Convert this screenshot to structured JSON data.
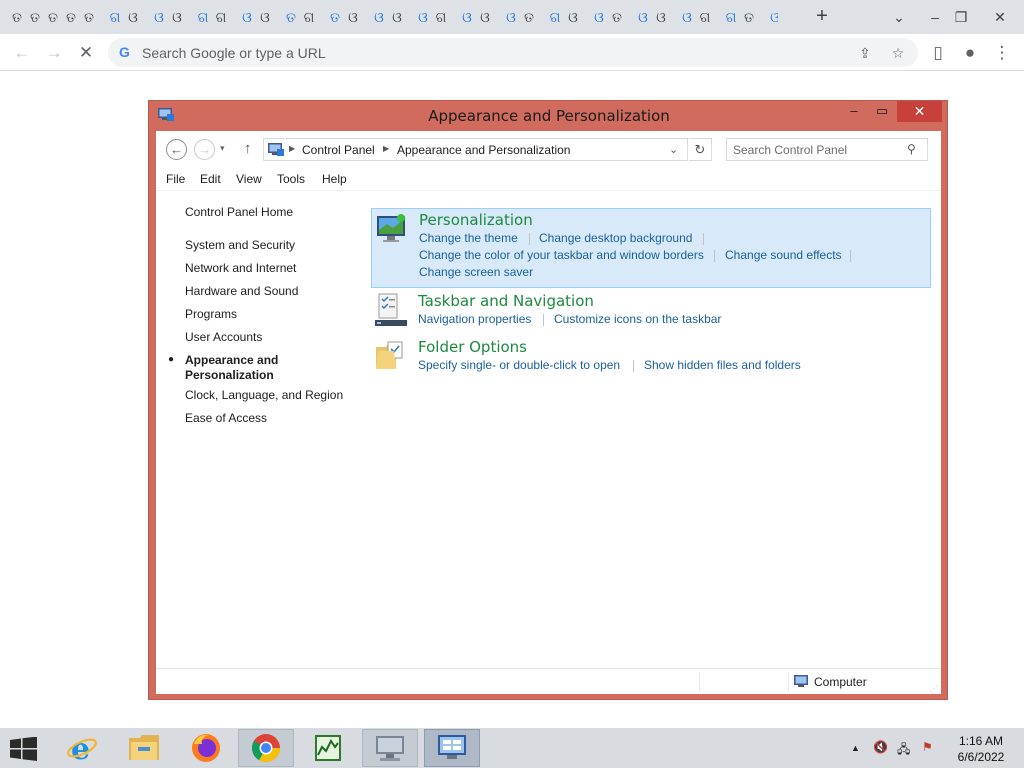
{
  "browser": {
    "tab_favicons": [
      "ତ",
      "ତ",
      "ତ",
      "ତ",
      "ତ",
      "ଗ",
      "ଓ",
      "ଓ",
      "ଓ",
      "ଗ",
      "ଗ",
      "ଓ",
      "ଓ",
      "ତ",
      "ଗ",
      "ତ",
      "ଓ",
      "ଓ",
      "ଓ",
      "ଓ",
      "ଗ",
      "ଓ",
      "ଓ",
      "ଓ",
      "ତ",
      "ଗ",
      "ଓ",
      "ଓ",
      "ତ",
      "ଓ",
      "ଓ",
      "ଓ",
      "ଗ",
      "ଗ",
      "ତ",
      "ଓ",
      "ଓ",
      "ଓ",
      "ଗ",
      "ଓ",
      "ଗ",
      "ତ"
    ],
    "new_tab_label": "+",
    "minimize_label": "–",
    "restore_label": "❐",
    "close_label": "✕",
    "back_label": "←",
    "forward_label": "→",
    "stop_label": "✕",
    "omnibox_placeholder": "Search Google or type a URL",
    "omnibox_google_glyph": "G",
    "share_icon": "⇪",
    "star_icon": "☆",
    "sidepanel_icon": "▯",
    "profile_icon": "●",
    "menu_icon": "⋮"
  },
  "window": {
    "title": "Appearance and Personalization",
    "min_label": "–",
    "max_label": "▭",
    "close_label": "✕",
    "back_label": "←",
    "forward_label": "→",
    "up_label": "↑",
    "dropdown_label": "▾",
    "refresh_label": "↻",
    "crumbs": [
      "Control Panel",
      "Appearance and Personalization"
    ],
    "crumb_sep": "▶",
    "addr_chevron": "⌄",
    "search_placeholder": "Search Control Panel",
    "search_icon": "⚲"
  },
  "menu": [
    "File",
    "Edit",
    "View",
    "Tools",
    "Help"
  ],
  "leftnav": {
    "home": "Control Panel Home",
    "items": [
      "System and Security",
      "Network and Internet",
      "Hardware and Sound",
      "Programs",
      "User Accounts"
    ],
    "current": "Appearance and Personalization",
    "current_bullet": "●",
    "after": [
      "Clock, Language, and Region",
      "Ease of Access"
    ]
  },
  "categories": [
    {
      "title": "Personalization",
      "links": [
        "Change the theme",
        "Change desktop background",
        "Change the color of your taskbar and window borders",
        "Change sound effects",
        "Change screen saver"
      ]
    },
    {
      "title": "Taskbar and Navigation",
      "links": [
        "Navigation properties",
        "Customize icons on the taskbar"
      ]
    },
    {
      "title": "Folder Options",
      "links": [
        "Specify single- or double-click to open",
        "Show hidden files and folders"
      ]
    }
  ],
  "status": {
    "text": "Computer",
    "grip": "⋰"
  },
  "taskbar": {
    "tray_up": "▲",
    "tray_volume": "🔇",
    "tray_network": "🖧",
    "tray_flag": "⚑",
    "time": "1:16 AM",
    "date": "6/6/2022"
  }
}
